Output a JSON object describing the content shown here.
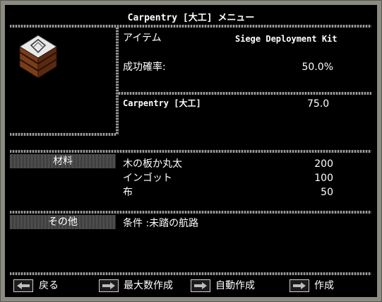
{
  "title": "Carpentry [大工] メニュー",
  "item": {
    "label": "アイテム",
    "name": "Siege Deployment Kit",
    "success_label": "成功確率:",
    "success_value": "50.0%"
  },
  "skill": {
    "name": "Carpentry [大工]",
    "value": "75.0"
  },
  "materials": {
    "header": "材料",
    "rows": [
      {
        "name": "木の板か丸太",
        "qty": "200"
      },
      {
        "name": "インゴット",
        "qty": "100"
      },
      {
        "name": "布",
        "qty": "50"
      }
    ]
  },
  "other": {
    "header": "その他",
    "condition": "条件 :未踏の航路"
  },
  "buttons": {
    "back": "戻る",
    "make_max": "最大数作成",
    "auto_make": "自動作成",
    "make": "作成"
  },
  "icons": {
    "item_image": "crate-icon",
    "button_arrow": "arrow-left-icon"
  }
}
